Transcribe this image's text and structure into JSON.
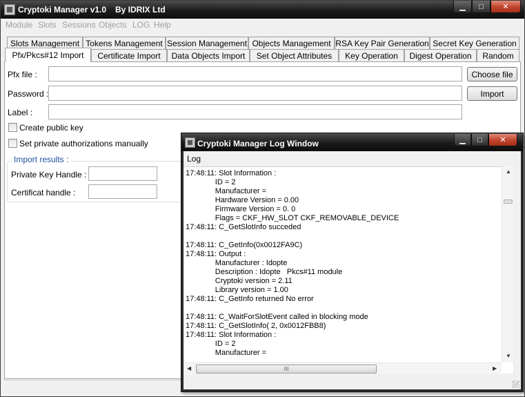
{
  "app": {
    "title": "Cryptoki Manager v1.0",
    "by": "By IDRIX Ltd"
  },
  "window_buttons": {
    "minimize": "▁",
    "maximize": "□",
    "close": "✕"
  },
  "menu": [
    "Module",
    "Slots",
    "Sessions",
    "Objects",
    "LOG",
    "Help"
  ],
  "tabs_row1": [
    "Slots Management",
    "Tokens Management",
    "Session Management",
    "Objects Management",
    "RSA Key Pair Generation",
    "Secret Key Generation"
  ],
  "tabs_row2": [
    "Pfx/Pkcs#12 Import",
    "Certificate Import",
    "Data Objects Import",
    "Set Object Attributes",
    "Key Operation",
    "Digest Operation",
    "Random"
  ],
  "active_tab": "Pfx/Pkcs#12 Import",
  "form": {
    "pfx_label": "Pfx file :",
    "pfx_value": "",
    "password_label": "Password :",
    "password_value": "",
    "label_label": "Label :",
    "label_value": "",
    "choose_file": "Choose file",
    "import": "Import",
    "create_public_key": "Create public key",
    "set_private_auth": "Set private authorizations manually",
    "create_public_key_checked": false,
    "set_private_auth_checked": false
  },
  "import_results": {
    "title": "Import results :",
    "private_key_label": "Private Key Handle :",
    "private_key_value": "",
    "certificate_label": "Certificat handle :",
    "certificate_value": ""
  },
  "log_window": {
    "title": "Cryptoki Manager Log Window",
    "menu": "Log",
    "lines": [
      "17:48:11: Slot Information :",
      "              ID = 2",
      "              Manufacturer =",
      "              Hardware Version = 0.00",
      "              Firmware Version = 0. 0",
      "              Flags = CKF_HW_SLOT CKF_REMOVABLE_DEVICE",
      "17:48:11: C_GetSlotInfo succeded",
      "",
      "17:48:11: C_GetInfo(0x0012FA9C)",
      "17:48:11: Output :",
      "              Manufacturer : Idopte",
      "              Description : Idopte   Pkcs#11 module",
      "              Cryptoki version = 2.11",
      "              Library version = 1.00",
      "17:48:11: C_GetInfo returned No error",
      "",
      "17:48:11: C_WaitForSlotEvent called in blocking mode",
      "17:48:11: C_GetSlotInfo( 2, 0x0012FBB8)",
      "17:48:11: Slot Information :",
      "              ID = 2",
      "              Manufacturer ="
    ],
    "scroll_up": "▲",
    "scroll_down": "▼",
    "scroll_left": "◀",
    "scroll_right": "▶",
    "hthumb_grip": "III"
  }
}
